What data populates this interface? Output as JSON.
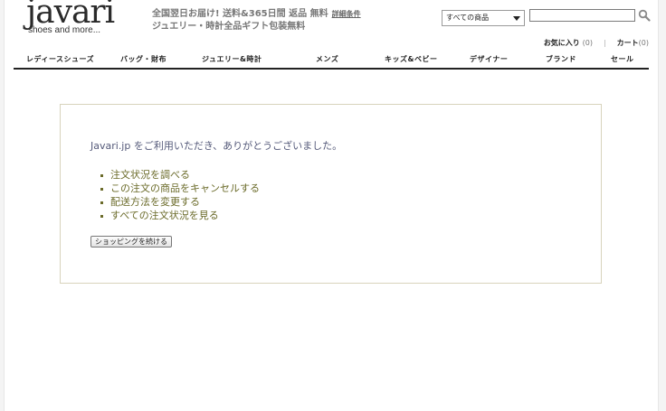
{
  "header": {
    "logo_word": "javari",
    "logo_tagline": "shoes and more...",
    "promo_line1": "全国翌日お届け! 送料&365日間 返品 無料",
    "promo_terms": "詳細条件",
    "promo_line2": "ジュエリー・時計全品ギフト包装無料"
  },
  "search": {
    "category_selected": "すべての商品",
    "query_value": "",
    "query_placeholder": ""
  },
  "account": {
    "favorites_label": "お気に入り",
    "favorites_count": "(0)",
    "separator": "|",
    "cart_label": "カート",
    "cart_count": "(0)"
  },
  "nav": {
    "items": [
      {
        "label": "レディースシューズ"
      },
      {
        "label": "バッグ・財布"
      },
      {
        "label": "ジュエリー&時計"
      },
      {
        "label": "メンズ"
      },
      {
        "label": "キッズ&ベビー"
      },
      {
        "label": "デザイナー"
      },
      {
        "label": "ブランド"
      },
      {
        "label": "セール"
      }
    ]
  },
  "main": {
    "thanks_message": "Javari.jp をご利用いただき、ありがとうございました。",
    "links": [
      {
        "label": "注文状況を調べる"
      },
      {
        "label": "この注文の商品をキャンセルする"
      },
      {
        "label": "配送方法を変更する"
      },
      {
        "label": "すべての注文状況を見る"
      }
    ],
    "continue_button": "ショッピングを続ける"
  },
  "colors": {
    "link": "#6b6b2a",
    "message": "#555a7a",
    "box_border": "#d8d3bc"
  },
  "icons": {
    "search": "magnifier-icon"
  }
}
